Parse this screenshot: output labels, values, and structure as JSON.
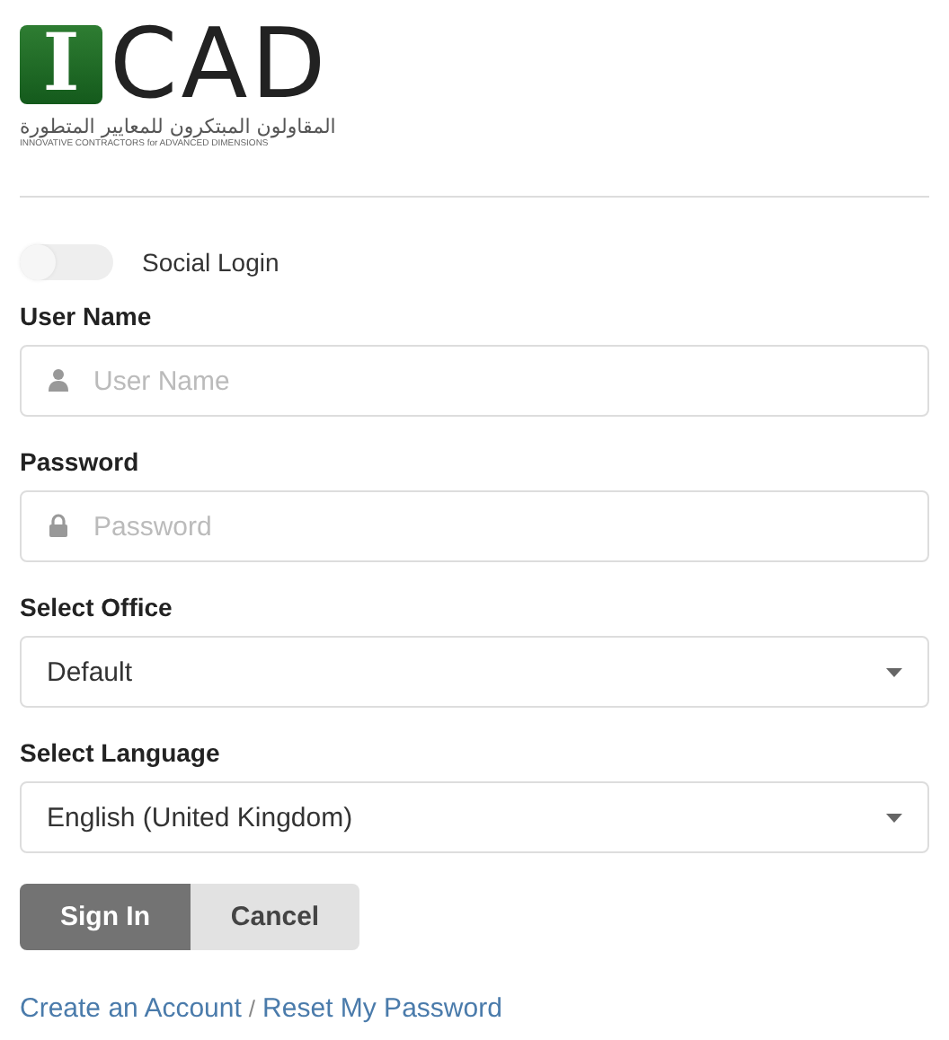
{
  "logo": {
    "letter": "I",
    "name": "CAD",
    "arabic": "المقاولون المبتكرون للمعايير المتطورة",
    "tagline": "INNOVATIVE CONTRACTORS for ADVANCED DIMENSIONS"
  },
  "social_login": {
    "label": "Social Login",
    "on": false
  },
  "fields": [
    {
      "kind": "text",
      "label": "User Name",
      "placeholder": "User Name"
    },
    {
      "kind": "password",
      "label": "Password",
      "placeholder": "Password"
    },
    {
      "kind": "select",
      "label": "Select Office",
      "value": "Default"
    },
    {
      "kind": "select",
      "label": "Select Language",
      "value": "English (United Kingdom)"
    }
  ],
  "buttons": [
    {
      "label": "Sign In",
      "primary": true
    },
    {
      "label": "Cancel",
      "primary": false
    }
  ],
  "links": [
    {
      "label": "Create an Account"
    },
    {
      "label": "Reset My Password"
    }
  ],
  "link_separator": "/"
}
